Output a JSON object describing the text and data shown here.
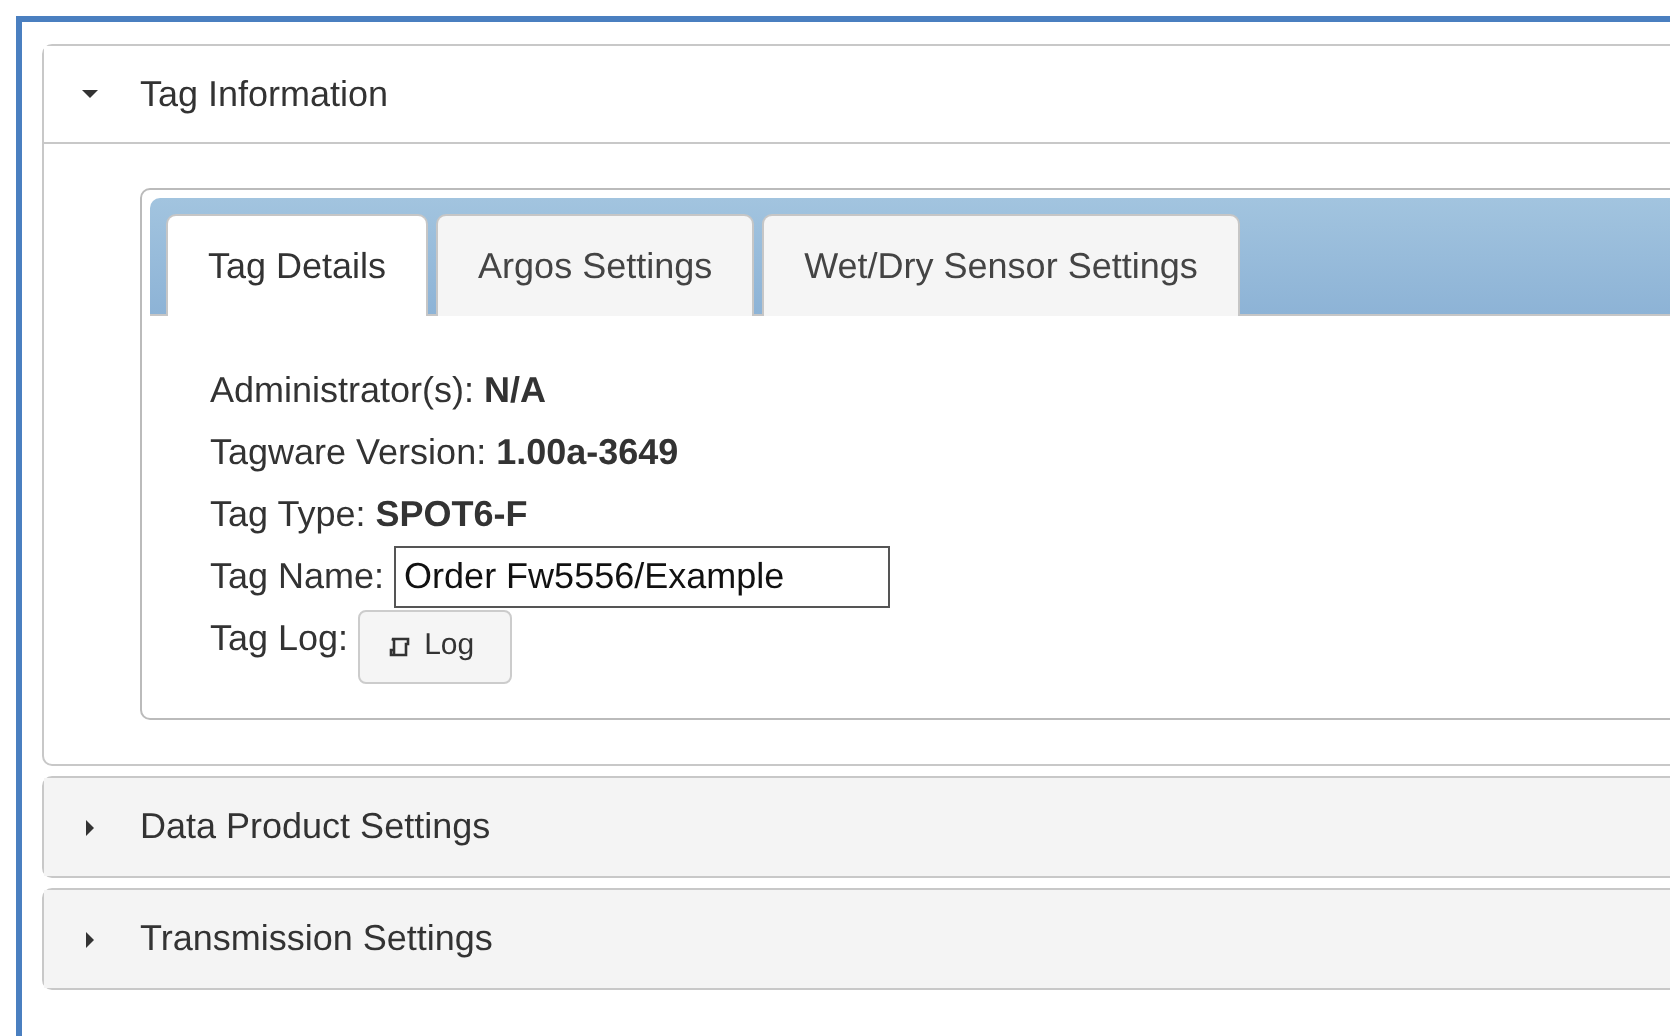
{
  "sections": [
    {
      "title": "Tag Information",
      "expanded": true,
      "tabs": [
        {
          "label": "Tag Details",
          "selected": true
        },
        {
          "label": "Argos Settings",
          "selected": false
        },
        {
          "label": "Wet/Dry Sensor Settings",
          "selected": false
        }
      ],
      "fields": [
        {
          "kind": "text",
          "label": "Administrator(s):",
          "value": "N/A"
        },
        {
          "kind": "text",
          "label": "Tagware Version:",
          "value": "1.00a-3649"
        },
        {
          "kind": "text",
          "label": "Tag Type:",
          "value": "SPOT6-F"
        },
        {
          "kind": "input",
          "label": "Tag Name:",
          "value": "Order Fw5556/Example"
        },
        {
          "kind": "button",
          "label": "Tag Log:",
          "value": "Log"
        }
      ]
    },
    {
      "title": "Data Product Settings",
      "expanded": false
    },
    {
      "title": "Transmission Settings",
      "expanded": false
    }
  ]
}
